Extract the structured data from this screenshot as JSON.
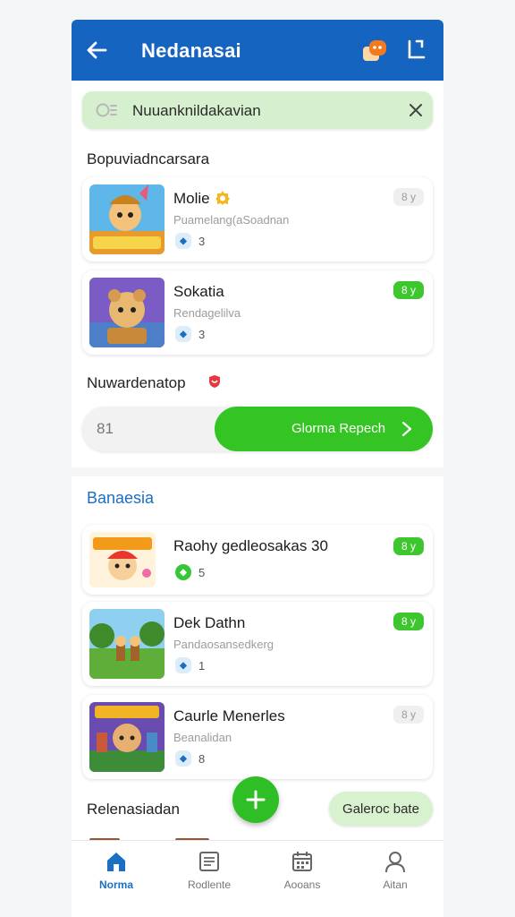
{
  "app": {
    "title": "Nedanasai"
  },
  "search": {
    "value": "Nuuanknildakavian",
    "placeholder": ""
  },
  "sections": {
    "first": "Bopuviadncarsara",
    "second": "Nuwardenatop",
    "third": "Banaesia",
    "fourth": "Relenasiadan"
  },
  "cards_top": [
    {
      "name": "Molie",
      "sub": "Puamelang(aSoadnan",
      "count": "3",
      "tag": "8 y"
    },
    {
      "name": "Sokatia",
      "sub": "Rendagelilva",
      "count": "3",
      "tag": "8 y"
    }
  ],
  "progress": {
    "value": "81",
    "button_label": "Glorma Repech"
  },
  "cards_bottom": [
    {
      "name": "Raohy gedleosakas 30",
      "sub": "",
      "count": "5",
      "tag": "8 y"
    },
    {
      "name": "Dek Dathn",
      "sub": "Pandaosansedkerg",
      "count": "1",
      "tag": "8 y"
    },
    {
      "name": "Caurle Menerles",
      "sub": "Beanalidan",
      "count": "8",
      "tag": "8 y"
    }
  ],
  "pill_button": {
    "label": "Galeroc bate"
  },
  "nav": [
    {
      "label": "Norma",
      "icon": "home-icon"
    },
    {
      "label": "Rodlente",
      "icon": "document-icon"
    },
    {
      "label": "Aooans",
      "icon": "calendar-icon"
    },
    {
      "label": "Aitan",
      "icon": "person-icon"
    }
  ],
  "colors": {
    "brand_blue": "#1565c0",
    "accent_green": "#34c424",
    "search_bg": "#d6f0cf"
  }
}
